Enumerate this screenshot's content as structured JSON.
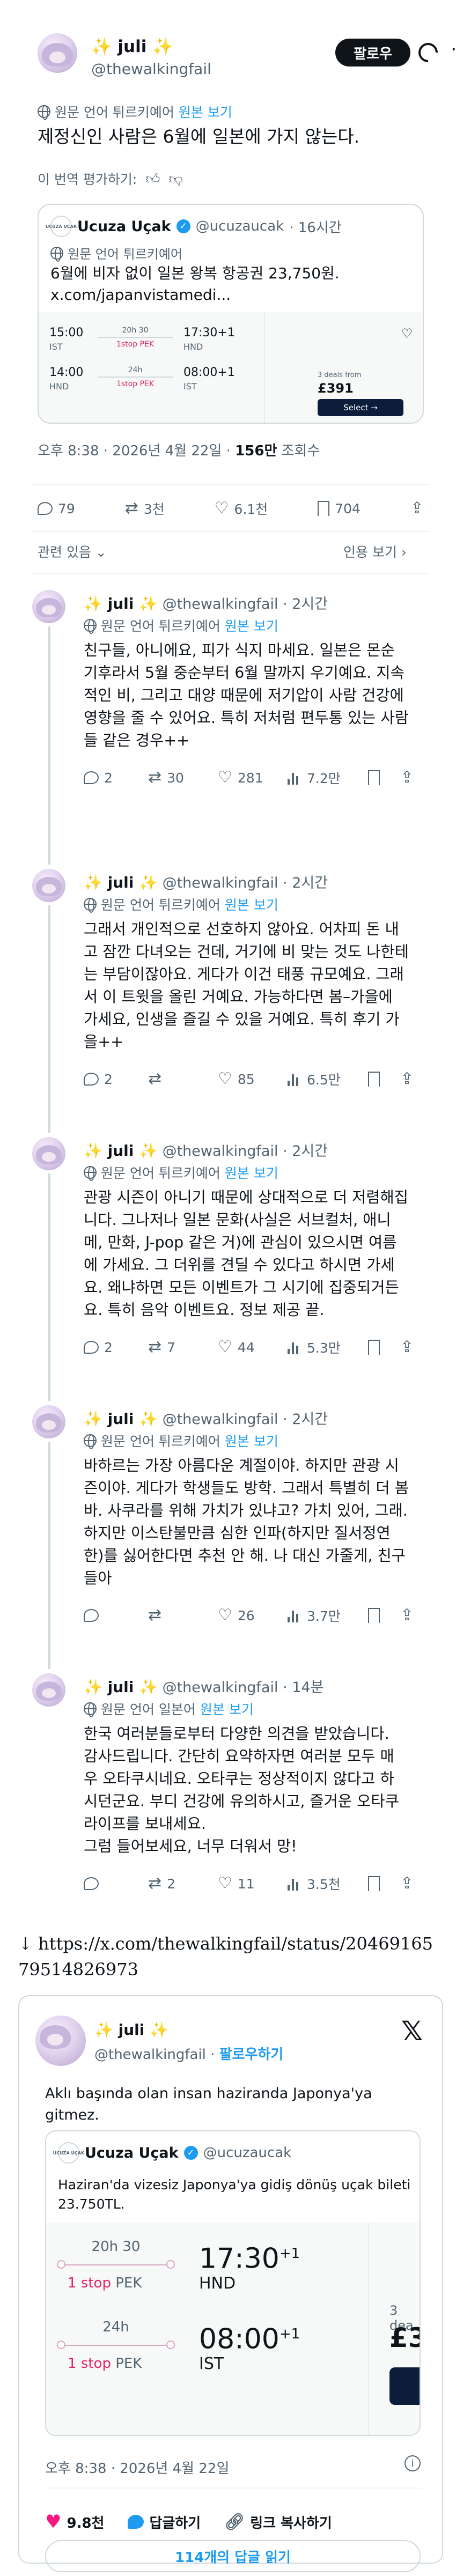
{
  "main_post": {
    "author_name": "juli",
    "sparkle": "✨",
    "handle": "@thewalkingfail",
    "follow_label": "팔로우",
    "translated_from": "원문 언어 튀르키예어",
    "view_original": "원본 보기",
    "text": "제정신인 사람은 6월에 일본에 가지 않는다.",
    "rate_translation": "이 번역 평가하기:",
    "timestamp": "오후 8:38 · 2026년 4월 22일 · ",
    "views_count": "156만",
    "views_label": " 조회수",
    "stats": {
      "replies": "79",
      "reposts": "3천",
      "likes": "6.1천",
      "bookmarks": "704"
    },
    "related_label": "관련 있음",
    "quotes_label": "인용 보기"
  },
  "quoted": {
    "name": "Ucuzа Uçak",
    "name_text": "Ucuza Uçak",
    "handle": "@ucuzaucak",
    "age": "· 16시간",
    "logo_text": "UCUZA UÇAK",
    "translated_from": "원문 언어 튀르키예어",
    "text": "6월에 비자 없이 일본 왕복 항공권 23,750원.",
    "link": "x.com/japanvistamedi...",
    "flights": [
      {
        "dep_time": "15:00",
        "dep_code": "IST",
        "duration": "20h 30",
        "stop": "1stop PEK",
        "arr_time": "17:30+1",
        "arr_code": "HND"
      },
      {
        "dep_time": "14:00",
        "dep_code": "HND",
        "duration": "24h",
        "stop": "1stop PEK",
        "arr_time": "08:00+1",
        "arr_code": "IST"
      }
    ],
    "deals_label": "3 deals from",
    "price": "£391",
    "select_label": "Select →"
  },
  "replies": [
    {
      "name": "juli",
      "handle": "@thewalkingfail",
      "age": "· 2시간",
      "translated_from": "원문 언어 튀르키예어",
      "view_original": "원본 보기",
      "lines": [
        "친구들, 아니에요, 피가 식지 마세요. 일본은 몬순",
        "기후라서 5월 중순부터 6월 말까지 우기예요. 지속",
        "적인 비, 그리고 대양 때문에 저기압이 사람 건강에",
        "영향을 줄 수 있어요. 특히 저처럼 편두통 있는 사람",
        "들 같은 경우++"
      ],
      "stats": {
        "replies": "2",
        "reposts": "30",
        "likes": "281",
        "views": "7.2만"
      }
    },
    {
      "name": "juli",
      "handle": "@thewalkingfail",
      "age": "· 2시간",
      "translated_from": "원문 언어 튀르키예어",
      "view_original": "원본 보기",
      "lines": [
        "그래서 개인적으로 선호하지 않아요. 어차피 돈 내",
        "고 잠깐 다녀오는 건데, 거기에 비 맞는 것도 나한테",
        "는 부담이잖아요. 게다가 이건 태풍 규모예요. 그래",
        "서 이 트윗을 올린 거예요. 가능하다면 봄–가을에",
        "가세요, 인생을 즐길 수 있을 거예요. 특히 후기 가",
        "을++"
      ],
      "stats": {
        "replies": "2",
        "reposts": "",
        "likes": "85",
        "views": "6.5만"
      }
    },
    {
      "name": "juli",
      "handle": "@thewalkingfail",
      "age": "· 2시간",
      "translated_from": "원문 언어 튀르키예어",
      "view_original": "원본 보기",
      "lines": [
        "관광 시즌이 아니기 때문에 상대적으로 더 저렴해집",
        "니다. 그나저나 일본 문화(사실은 서브컬처, 애니",
        "메, 만화, J-pop 같은 거)에 관심이 있으시면 여름",
        "에 가세요. 그 더위를 견딜 수 있다고 하시면 가세",
        "요. 왜냐하면 모든 이벤트가 그 시기에 집중되거든",
        "요. 특히 음악 이벤트요. 정보 제공 끝."
      ],
      "stats": {
        "replies": "2",
        "reposts": "7",
        "likes": "44",
        "views": "5.3만"
      }
    },
    {
      "name": "juli",
      "handle": "@thewalkingfail",
      "age": "· 2시간",
      "translated_from": "원문 언어 튀르키예어",
      "view_original": "원본 보기",
      "lines": [
        "바하르는 가장 아름다운 계절이야. 하지만 관광 시",
        "즌이야. 게다가 학생들도 방학. 그래서 특별히 더 봄",
        "바. 사쿠라를 위해 가치가 있냐고? 가치 있어, 그래.",
        "하지만 이스탄불만큼 심한 인파(하지만 질서정연",
        "한)를 싫어한다면 추천 안 해. 나 대신 가줄게, 친구",
        "들아"
      ],
      "stats": {
        "replies": "",
        "reposts": "",
        "likes": "26",
        "views": "3.7만"
      }
    },
    {
      "name": "juli",
      "handle": "@thewalkingfail",
      "age": "· 14분",
      "translated_from": "원문 언어 일본어",
      "view_original": "원본 보기",
      "lines": [
        "한국 여러분들로부터 다양한 의견을 받았습니다.",
        "감사드립니다. 간단히 요약하자면 여러분 모두 매",
        "우 오타쿠시네요. 오타쿠는 정상적이지 않다고 하",
        "시던군요. 부디 건강에 유의하시고, 즐거운 오타쿠",
        "라이프를 보내세요.",
        "그럼 들어보세요, 너무 더워서 망!"
      ],
      "stats": {
        "replies": "",
        "reposts": "2",
        "likes": "11",
        "views": "3.5천"
      }
    }
  ],
  "embed": {
    "arrow": "↓",
    "url": "https://x.com/thewalkingfail/status/2046916579514826973",
    "name": "juli",
    "handle": "@thewalkingfail",
    "follow_label": "팔로우하기",
    "text": "Aklı başında olan insan haziranda Japonya'ya gitmez.",
    "quoted_name": "Ucuza Uçak",
    "quoted_handle": "@ucuzaucak",
    "quoted_text": "Haziran'da vizesiz Japonya'ya gidiş dönüş uçak bileti 23.750TL.",
    "flights": [
      {
        "duration": "20h 30",
        "stop": "1 stop",
        "stop_code": "PEK",
        "arr_time": "17:30",
        "sup": "+1",
        "arr_code": "HND"
      },
      {
        "duration": "24h",
        "stop": "1 stop",
        "stop_code": "PEK",
        "arr_time": "08:00",
        "sup": "+1",
        "arr_code": "IST"
      }
    ],
    "deals_partial": "3 dea",
    "price_partial": "£3",
    "timestamp": "오후 8:38 · 2026년 4월 22일",
    "likes": "9.8천",
    "reply_label": "답글하기",
    "copy_label": "링크 복사하기",
    "read_replies": "114개의 답글 읽기",
    "colors": {
      "like": "#f91880",
      "link": "#1d9bf0"
    }
  }
}
